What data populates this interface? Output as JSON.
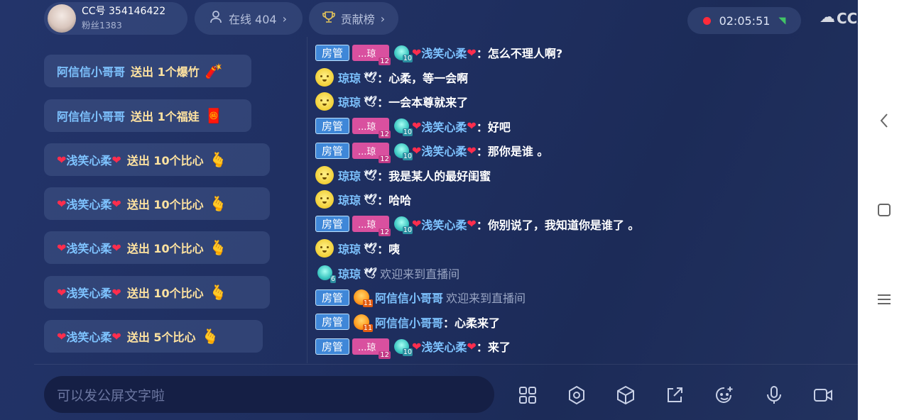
{
  "header": {
    "host_id": "CC号 354146422",
    "host_fans": "粉丝1383",
    "online": "在线 404",
    "rank": "贡献榜",
    "timer": "02:05:51",
    "logo": "CC直播"
  },
  "gifts": [
    {
      "name": "阿信信小哥哥",
      "action": "送出 1个爆竹",
      "icon": "🧨"
    },
    {
      "name": "阿信信小哥哥",
      "action": "送出 1个福娃",
      "icon": "🧧"
    },
    {
      "name": "浅笑心柔",
      "action": "送出 10个比心",
      "icon": "🫰"
    },
    {
      "name": "浅笑心柔",
      "action": "送出 10个比心",
      "icon": "🫰"
    },
    {
      "name": "浅笑心柔",
      "action": "送出 10个比心",
      "icon": "🫰"
    },
    {
      "name": "浅笑心柔",
      "action": "送出 10个比心",
      "icon": "🫰"
    },
    {
      "name": "浅笑心柔",
      "action": "送出 5个比心",
      "icon": "🫰"
    }
  ],
  "badges": {
    "admin": "房管",
    "fan": "...琼",
    "fan_level": "12",
    "gem_level": "10",
    "gem_small": "6",
    "sun_level": "11",
    "heart": "❤",
    "dove": "🕊",
    "colon": "："
  },
  "chat": [
    {
      "name": "浅笑心柔",
      "text": "怎么不理人啊?"
    },
    {
      "name": "琼琼",
      "text": "心柔，等一会啊"
    },
    {
      "name": "琼琼",
      "text": "一会本尊就来了"
    },
    {
      "name": "浅笑心柔",
      "text": "好吧"
    },
    {
      "name": "浅笑心柔",
      "text": "那你是谁 。"
    },
    {
      "name": "琼琼",
      "text": "我是某人的最好闺蜜"
    },
    {
      "name": "琼琼",
      "text": "哈哈"
    },
    {
      "name": "浅笑心柔",
      "text": "你别说了，我知道你是谁了 。"
    },
    {
      "name": "琼琼",
      "text": "咦"
    },
    {
      "name": "琼琼",
      "text": "欢迎来到直播间"
    },
    {
      "name": "阿信信小哥哥",
      "text": "欢迎来到直播间"
    },
    {
      "name": "阿信信小哥哥",
      "text": "心柔来了"
    },
    {
      "name": "浅笑心柔",
      "text": "来了"
    }
  ],
  "input": {
    "placeholder": "可以发公屏文字啦"
  },
  "icons": [
    "grid-icon",
    "settings-icon",
    "cube-icon",
    "share-icon",
    "emoji-icon",
    "mic-icon",
    "camera-icon"
  ],
  "colors": {
    "accent": "#3f87d8",
    "name": "#7ec3ff",
    "heart": "#ff2d4d",
    "record": "#ff2a3a"
  }
}
